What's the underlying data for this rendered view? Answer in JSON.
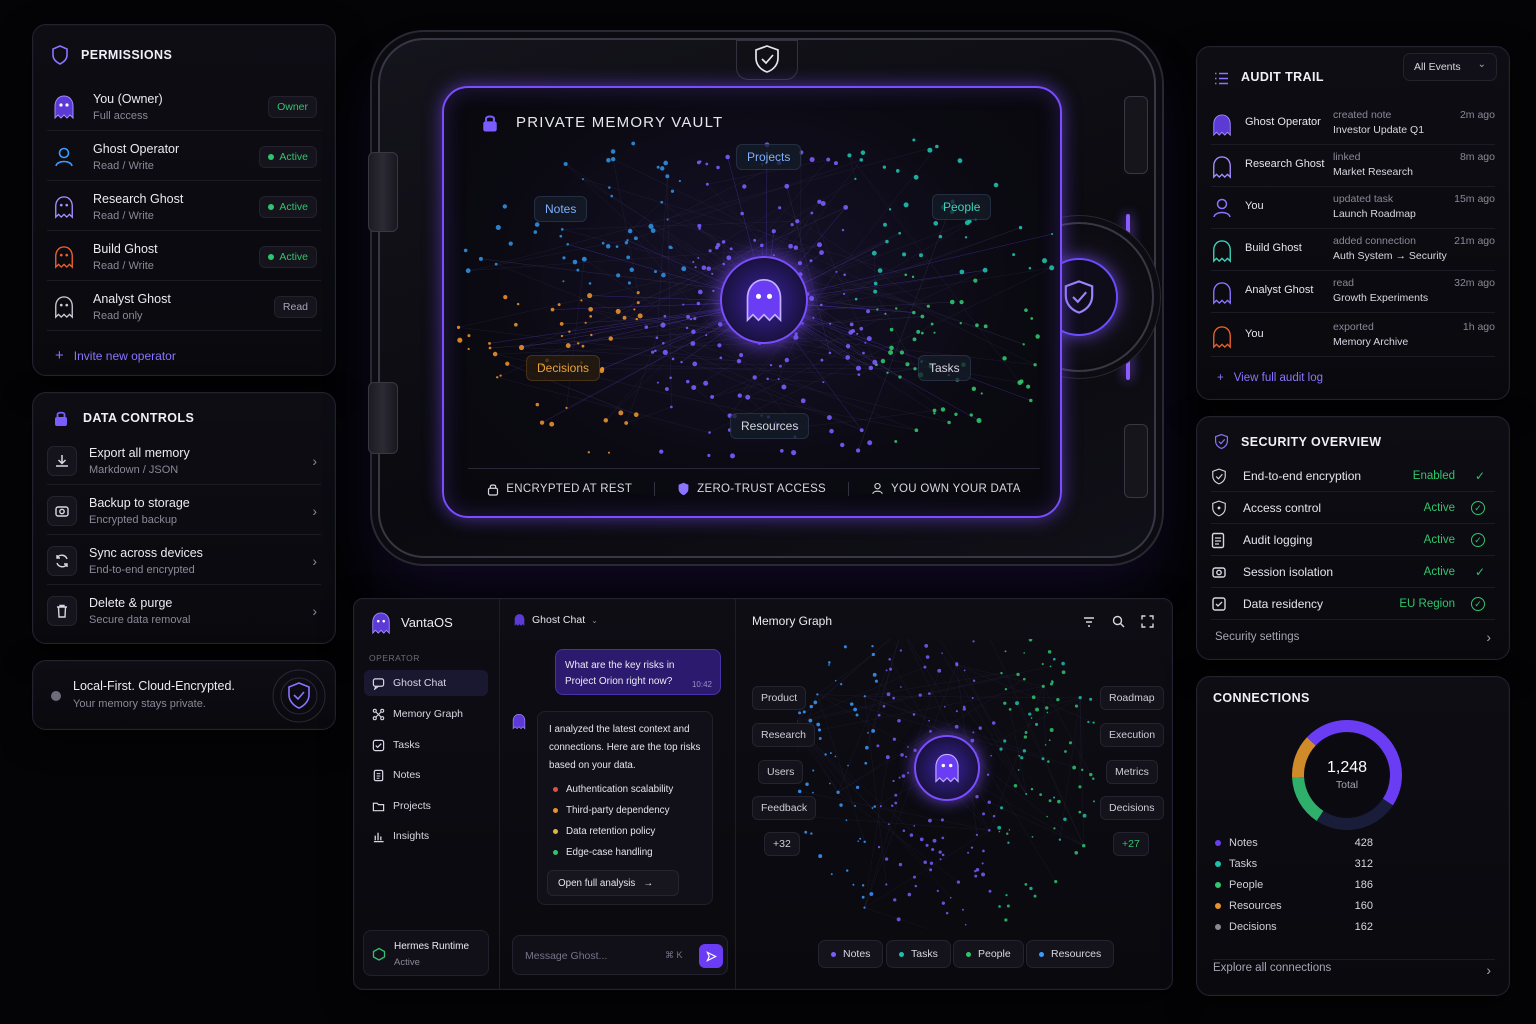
{
  "permissions": {
    "title": "PERMISSIONS",
    "rows": [
      {
        "name": "You (Owner)",
        "role": "Full access",
        "badge": "Owner"
      },
      {
        "name": "Ghost Operator",
        "role": "Read / Write",
        "badge": "Active"
      },
      {
        "name": "Research Ghost",
        "role": "Read / Write",
        "badge": "Active"
      },
      {
        "name": "Build Ghost",
        "role": "Read / Write",
        "badge": "Active"
      },
      {
        "name": "Analyst Ghost",
        "role": "Read only",
        "badge": "Read"
      }
    ],
    "invite": "Invite new operator"
  },
  "data_controls": {
    "title": "DATA CONTROLS",
    "rows": [
      {
        "name": "Export all memory",
        "sub": "Markdown / JSON"
      },
      {
        "name": "Backup to storage",
        "sub": "Encrypted backup"
      },
      {
        "name": "Sync across devices",
        "sub": "End-to-end encrypted"
      },
      {
        "name": "Delete & purge",
        "sub": "Secure data removal"
      }
    ]
  },
  "local_first": {
    "title": "Local-First. Cloud-Encrypted.",
    "sub": "Your memory stays private."
  },
  "vault": {
    "title": "PRIVATE MEMORY VAULT",
    "chips": {
      "projects": "Projects",
      "notes": "Notes",
      "people": "People",
      "decisions": "Decisions",
      "tasks": "Tasks",
      "resources": "Resources"
    },
    "footer": [
      "ENCRYPTED AT REST",
      "ZERO-TRUST ACCESS",
      "YOU OWN YOUR DATA"
    ]
  },
  "app": {
    "brand": "VantaOS",
    "section": "OPERATOR",
    "nav": [
      "Ghost Chat",
      "Memory Graph",
      "Tasks",
      "Notes",
      "Projects",
      "Insights"
    ],
    "runtime": {
      "name": "Hermes Runtime",
      "status": "Active"
    }
  },
  "chat": {
    "header": "Ghost Chat",
    "user_msg": "What are the key risks in Project Orion right now?",
    "user_time": "10:42",
    "reply_intro": "I analyzed the latest context and connections. Here are the top risks based on your data.",
    "risks": [
      {
        "label": "Authentication scalability",
        "color": "#e2503e"
      },
      {
        "label": "Third-party dependency",
        "color": "#e8902e"
      },
      {
        "label": "Data retention policy",
        "color": "#e8b23e"
      },
      {
        "label": "Edge-case handling",
        "color": "#2fc56e"
      }
    ],
    "open_analysis": "Open full analysis",
    "input_placeholder": "Message Ghost...",
    "shortcut": "⌘ K"
  },
  "memory_graph": {
    "title": "Memory Graph",
    "left_chips": [
      "Product",
      "Research",
      "Users",
      "Feedback",
      "+32"
    ],
    "right_chips": [
      "Roadmap",
      "Execution",
      "Metrics",
      "Decisions",
      "+27"
    ],
    "legend": [
      {
        "label": "Notes",
        "color": "#7b5cff"
      },
      {
        "label": "Tasks",
        "color": "#1fbfae"
      },
      {
        "label": "People",
        "color": "#2fc56e"
      },
      {
        "label": "Resources",
        "color": "#3b9bff"
      }
    ]
  },
  "audit": {
    "title": "AUDIT TRAIL",
    "filter": "All Events",
    "rows": [
      {
        "name": "Ghost Operator",
        "action": "created note",
        "target": "Investor Update Q1",
        "time": "2m ago"
      },
      {
        "name": "Research Ghost",
        "action": "linked",
        "target": "Market Research",
        "time": "8m ago"
      },
      {
        "name": "You",
        "action": "updated task",
        "target": "Launch Roadmap",
        "time": "15m ago"
      },
      {
        "name": "Build Ghost",
        "action": "added connection",
        "target": "Auth System → Security",
        "time": "21m ago"
      },
      {
        "name": "Analyst Ghost",
        "action": "read",
        "target": "Growth Experiments",
        "time": "32m ago"
      },
      {
        "name": "You",
        "action": "exported",
        "target": "Memory Archive",
        "time": "1h ago"
      }
    ],
    "view_all": "View full audit log"
  },
  "security": {
    "title": "SECURITY OVERVIEW",
    "rows": [
      {
        "name": "End-to-end encryption",
        "status": "Enabled"
      },
      {
        "name": "Access control",
        "status": "Active"
      },
      {
        "name": "Audit logging",
        "status": "Active"
      },
      {
        "name": "Session isolation",
        "status": "Active"
      },
      {
        "name": "Data residency",
        "status": "EU Region"
      }
    ],
    "settings": "Security settings"
  },
  "connections": {
    "title": "CONNECTIONS",
    "total_value": "1,248",
    "total_label": "Total",
    "explore": "Explore all connections"
  },
  "chart_data": {
    "type": "pie",
    "categories": [
      "Notes",
      "Tasks",
      "People",
      "Resources",
      "Decisions"
    ],
    "values": [
      428,
      312,
      186,
      160,
      162
    ],
    "colors": [
      "#6a3df5",
      "#1fbfae",
      "#2fc56e",
      "#e8902e",
      "#8a8795"
    ],
    "chart_colors": [
      "#6a3df5",
      "#1a1d3a",
      "#2fb06a",
      "#d08a2a",
      "#6a3df5"
    ]
  }
}
